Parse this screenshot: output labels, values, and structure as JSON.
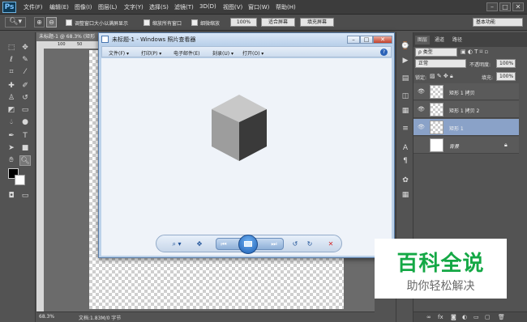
{
  "app": {
    "logo": "Ps"
  },
  "menubar": {
    "items": [
      "文件(F)",
      "编辑(E)",
      "图像(I)",
      "图层(L)",
      "文字(Y)",
      "选择(S)",
      "滤镜(T)",
      "3D(D)",
      "视图(V)",
      "窗口(W)",
      "帮助(H)"
    ],
    "window_controls": [
      "–",
      "□",
      "✕"
    ]
  },
  "options": {
    "checkbox1_label": "调整窗口大小以满屏显示",
    "checkbox2_label": "缩放所有窗口",
    "checkbox3_label": "细微缩放",
    "zoom_value": "100%",
    "fit_screen": "适合屏幕",
    "fill_screen": "填充屏幕",
    "workspace": "基本功能"
  },
  "document": {
    "tab_title": "未标题-1 @ 68.3% (矩形",
    "ruler_marks": [
      "100",
      "50"
    ],
    "status_zoom": "68.3%",
    "status_doc": "文档:1.83M/0 字节"
  },
  "viewer": {
    "title": "未标题-1 - Windows 照片查看器",
    "menu": [
      "文件(F) ▾",
      "打印(P) ▾",
      "电子邮件(E)",
      "刻录(U) ▾",
      "打开(O) ▾"
    ],
    "help": "?",
    "controls": {
      "zoom": "⌕ ▾",
      "fit": "✥",
      "prev": "⏮",
      "next": "⏭",
      "rotate_ccw": "↺",
      "rotate_cw": "↻",
      "delete": "✕"
    }
  },
  "panel": {
    "tabs": [
      "图层",
      "通道",
      "路径"
    ],
    "filter_select": "ρ 类型",
    "blend_select": "正常",
    "opacity_label": "不透明度:",
    "opacity_value": "100%",
    "lock_label": "锁定:",
    "fill_label": "填充:",
    "fill_value": "100%",
    "layers": [
      {
        "name": "矩形 1 拷贝",
        "selected": false,
        "visible": true
      },
      {
        "name": "矩形 1 拷贝 2",
        "selected": false,
        "visible": true
      },
      {
        "name": "矩形 1",
        "selected": true,
        "visible": true
      },
      {
        "name": "背景",
        "selected": false,
        "visible": false
      }
    ]
  },
  "watermark": {
    "main": "百科全说",
    "sub": "助你轻松解决"
  },
  "colors": {
    "accent": "#14a845",
    "selected_layer": "#8aa2c8",
    "ps_bg": "#535353"
  }
}
